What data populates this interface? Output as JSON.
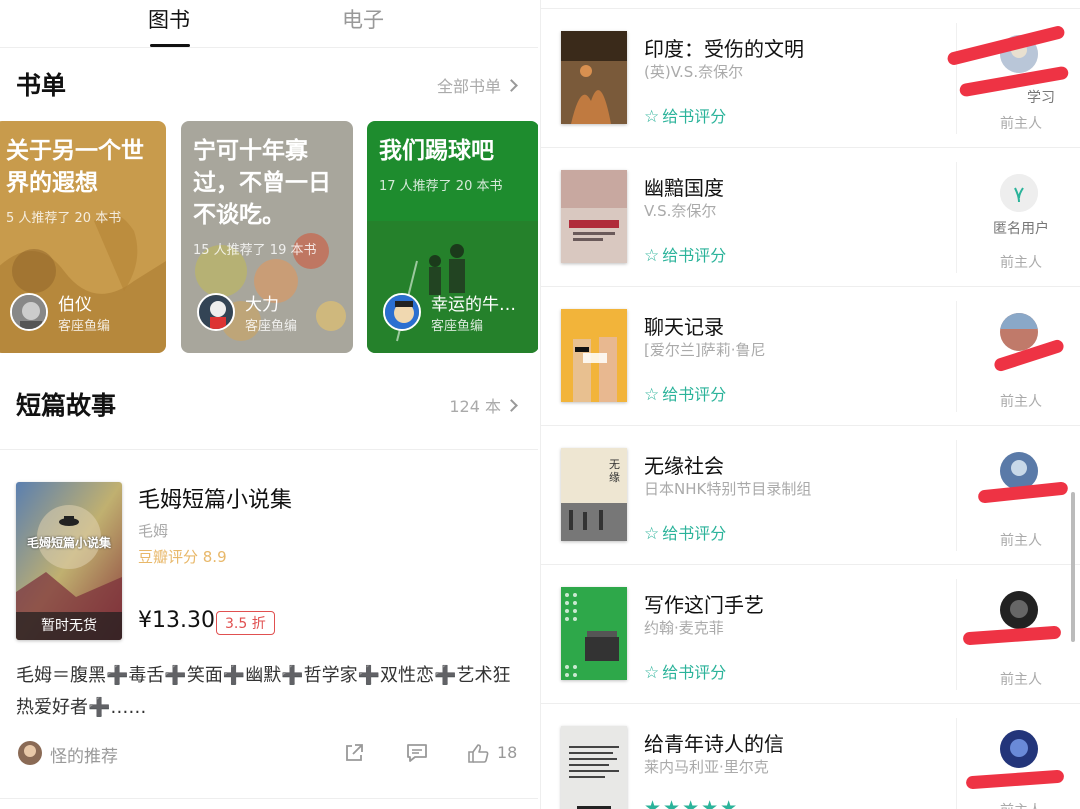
{
  "tabs": [
    {
      "label": "图书",
      "active": true
    },
    {
      "label": "电子",
      "active": false
    }
  ],
  "booklists": {
    "title": "书单",
    "link": "全部书单",
    "cards": [
      {
        "title": "关于另一个世界的遐想",
        "sub": "5 人推荐了 20 本书",
        "author": "伯仪",
        "role": "客座鱼编",
        "color": "#c89b4c"
      },
      {
        "title": "宁可十年寡过，不曾一日不谈吃。",
        "sub": "15 人推荐了 19 本书",
        "author": "大力",
        "role": "客座鱼编",
        "color": "#a8a69c"
      },
      {
        "title": "我们踢球吧",
        "sub": "17 人推荐了 20 本书",
        "author": "幸运的牛…",
        "role": "客座鱼编",
        "color": "#1e8c2e"
      }
    ]
  },
  "stories": {
    "title": "短篇故事",
    "count": "124 本",
    "book": {
      "title": "毛姆短篇小说集",
      "author": "毛姆",
      "rating": "豆瓣评分 8.9",
      "price": "¥13.30",
      "discount": "3.5 折",
      "stock": "暂时无货",
      "cover_text": "毛姆短篇小说集",
      "description": "毛姆＝腹黑➕毒舌➕笑面➕幽默➕哲学家➕双性恋➕艺术狂热爱好者➕……",
      "recommender": "怪的推荐",
      "likes": "18"
    }
  },
  "records": [
    {
      "title": "印度：受伤的文明",
      "author": "(英)V.S.奈保尔",
      "rate": "给书评分",
      "owner": "学习",
      "role": "前主人",
      "cover": "#7a5a3a",
      "cover_text": "印度：受伤的文明"
    },
    {
      "title": "幽黯国度",
      "author": "V.S.奈保尔",
      "rate": "给书评分",
      "owner": "匿名用户",
      "role": "前主人",
      "cover": "#d9c8c0",
      "cover_text": "幽黯国度"
    },
    {
      "title": "聊天记录",
      "author": "[爱尔兰]萨莉·鲁尼",
      "rate": "给书评分",
      "owner": "",
      "role": "前主人",
      "cover": "#f2b43a",
      "cover_text": "聊天记录"
    },
    {
      "title": "无缘社会",
      "author": "日本NHK特别节目录制组",
      "rate": "给书评分",
      "owner": "",
      "role": "前主人",
      "cover": "#eee6d2",
      "cover_text": "无缘社会"
    },
    {
      "title": "写作这门手艺",
      "author": "约翰·麦克菲",
      "rate": "给书评分",
      "owner": "",
      "role": "前主人",
      "cover": "#2ea84a",
      "cover_text": "写作这门手艺"
    },
    {
      "title": "给青年诗人的信",
      "author": "莱内马利亚·里尔克",
      "rate": "",
      "owner": "",
      "role": "前主人",
      "cover": "#e8e8e6",
      "cover_text": "给青年诗人的信",
      "stars": "★★★★★"
    }
  ],
  "colors": {
    "accent": "#2bb39a",
    "discount": "#e05050",
    "rating": "#e8b86a"
  }
}
